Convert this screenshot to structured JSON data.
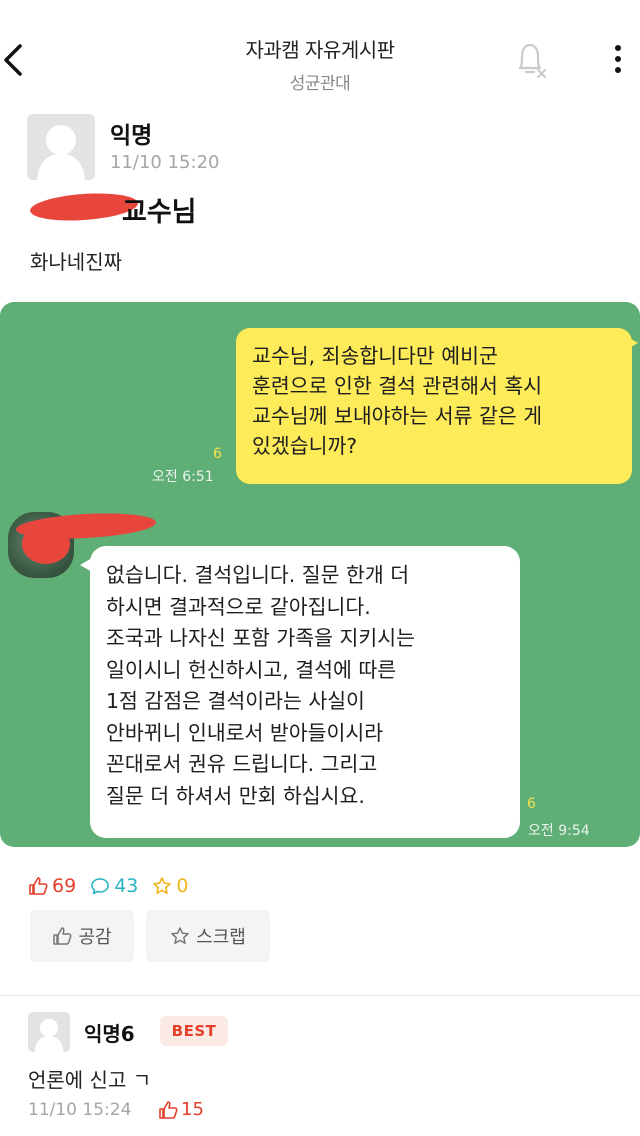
{
  "header": {
    "title": "자과캠 자유게시판",
    "subtitle": "성균관대",
    "icons": {
      "back": "back-arrow-icon",
      "bell": "bell-off-icon",
      "menu": "more-vertical-icon"
    }
  },
  "post": {
    "author": "익명",
    "time": "11/10 15:20",
    "title_visible": "교수님",
    "body": "화나네진짜"
  },
  "chat": {
    "outgoing": {
      "text": "교수님, 죄송합니다만 예비군\n훈련으로 인한 결석 관련해서 혹시\n교수님께 보내야하는 서류 같은 게\n있겠습니까?",
      "read_count": "6",
      "time": "오전 6:51"
    },
    "incoming": {
      "text": "없습니다. 결석입니다. 질문 한개 더\n하시면 결과적으로 같아집니다.\n조국과 나자신 포함 가족을 지키시는\n일이시니 헌신하시고, 결석에 따른\n1점 감점은 결석이라는 사실이\n안바뀌니  인내로서 받아들이시라\n꼰대로서 권유 드립니다. 그리고\n질문 더 하셔서 만회 하십시요.",
      "read_count": "6",
      "time": "오전 9:54"
    },
    "colors": {
      "background": "#5fae76",
      "outgoing_bubble": "#fdeb5a",
      "incoming_bubble": "#ffffff",
      "redaction": "#e8453c"
    }
  },
  "stats": {
    "likes": "69",
    "comments": "43",
    "scraps": "0"
  },
  "actions": {
    "like_label": "공감",
    "scrap_label": "스크랩"
  },
  "comment": {
    "author": "익명6",
    "badge": "BEST",
    "text": "언론에 신고 ㄱ",
    "time": "11/10 15:24",
    "likes": "15"
  },
  "accent_colors": {
    "like": "#e2402b",
    "comment": "#2ab2bf",
    "scrap": "#f0b51c"
  }
}
